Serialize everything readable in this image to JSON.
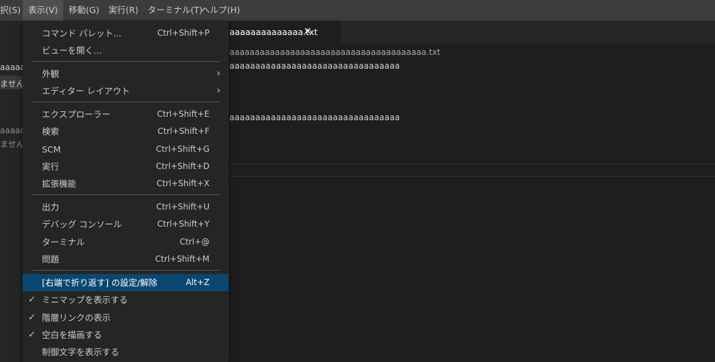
{
  "menubar": {
    "items": [
      "択(S)",
      "表示(V)",
      "移動(G)",
      "実行(R)",
      "ターミナル(T)",
      "ヘルプ(H)"
    ]
  },
  "sidebar": {
    "items": [
      "aaaaaa",
      "ません",
      "aaaaaa",
      "ません"
    ]
  },
  "tab": {
    "label": "aaaaaaaaaaaaaa.txt",
    "close": "✕"
  },
  "editor": {
    "breadcrumb": "aaaaaaaaaaaaaaaaaaaaaaaaaaaaaaaaaaaaaaa.txt",
    "lines": [
      "aaaaaaaaaaaaaaaaaaaaaaaaaaaaaaaaa",
      "aaaaaaaaaaaaaaaaaaaaaaaaaaaaaaaaa"
    ]
  },
  "view_menu": {
    "items": [
      {
        "label": "コマンド パレット...",
        "shortcut": "Ctrl+Shift+P"
      },
      {
        "label": "ビューを開く...",
        "shortcut": ""
      },
      {
        "label": "外観",
        "shortcut": "",
        "submenu": true
      },
      {
        "label": "エディター レイアウト",
        "shortcut": "",
        "submenu": true
      },
      {
        "label": "エクスプローラー",
        "shortcut": "Ctrl+Shift+E"
      },
      {
        "label": "検索",
        "shortcut": "Ctrl+Shift+F"
      },
      {
        "label": "SCM",
        "shortcut": "Ctrl+Shift+G"
      },
      {
        "label": "実行",
        "shortcut": "Ctrl+Shift+D"
      },
      {
        "label": "拡張機能",
        "shortcut": "Ctrl+Shift+X"
      },
      {
        "label": "出力",
        "shortcut": "Ctrl+Shift+U"
      },
      {
        "label": "デバッグ コンソール",
        "shortcut": "Ctrl+Shift+Y"
      },
      {
        "label": "ターミナル",
        "shortcut": "Ctrl+@"
      },
      {
        "label": "問題",
        "shortcut": "Ctrl+Shift+M"
      },
      {
        "label": "[右端で折り返す] の設定/解除",
        "shortcut": "Alt+Z",
        "selected": true
      },
      {
        "label": "ミニマップを表示する",
        "shortcut": "",
        "checked": true
      },
      {
        "label": "階層リンクの表示",
        "shortcut": "",
        "checked": true
      },
      {
        "label": "空白を描画する",
        "shortcut": "",
        "checked": true
      },
      {
        "label": "制御文字を表示する",
        "shortcut": ""
      }
    ],
    "submenu_glyph": "›",
    "check_glyph": "✓"
  },
  "colors": {
    "menubar_bg": "#3c3c3c",
    "menu_bg": "#252526",
    "selection_bg": "#094771",
    "editor_bg": "#1e1e1e"
  }
}
